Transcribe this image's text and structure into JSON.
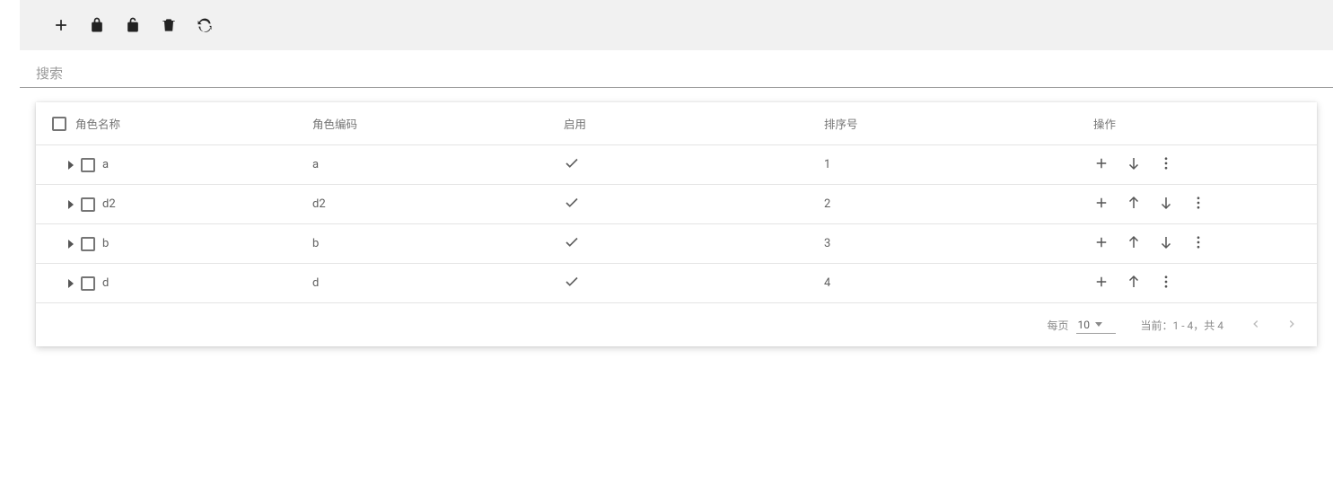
{
  "search": {
    "placeholder": "搜索"
  },
  "table": {
    "headers": {
      "name": "角色名称",
      "code": "角色编码",
      "enabled": "启用",
      "sort": "排序号",
      "actions": "操作"
    },
    "rows": [
      {
        "name": "a",
        "code": "a",
        "enabled": true,
        "sort": "1",
        "canUp": false,
        "canDown": true
      },
      {
        "name": "d2",
        "code": "d2",
        "enabled": true,
        "sort": "2",
        "canUp": true,
        "canDown": true
      },
      {
        "name": "b",
        "code": "b",
        "enabled": true,
        "sort": "3",
        "canUp": true,
        "canDown": true
      },
      {
        "name": "d",
        "code": "d",
        "enabled": true,
        "sort": "4",
        "canUp": true,
        "canDown": false
      }
    ]
  },
  "pagination": {
    "per_page_label": "每页",
    "per_page_value": "10",
    "range_text": "当前：1 - 4，共 4"
  }
}
